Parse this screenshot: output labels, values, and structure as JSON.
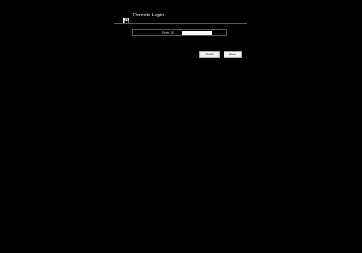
{
  "header": {
    "icon": "lock-icon",
    "title": "Remote Login"
  },
  "form": {
    "field_label": "Enter ID",
    "field_value": ""
  },
  "buttons": {
    "login_label": "LOGIN",
    "clear_label": "Clear"
  },
  "colors": {
    "background": "#000000",
    "text": "#e6e6e6",
    "divider": "#5a5a5a",
    "button_bg": "#f2f2f2"
  }
}
